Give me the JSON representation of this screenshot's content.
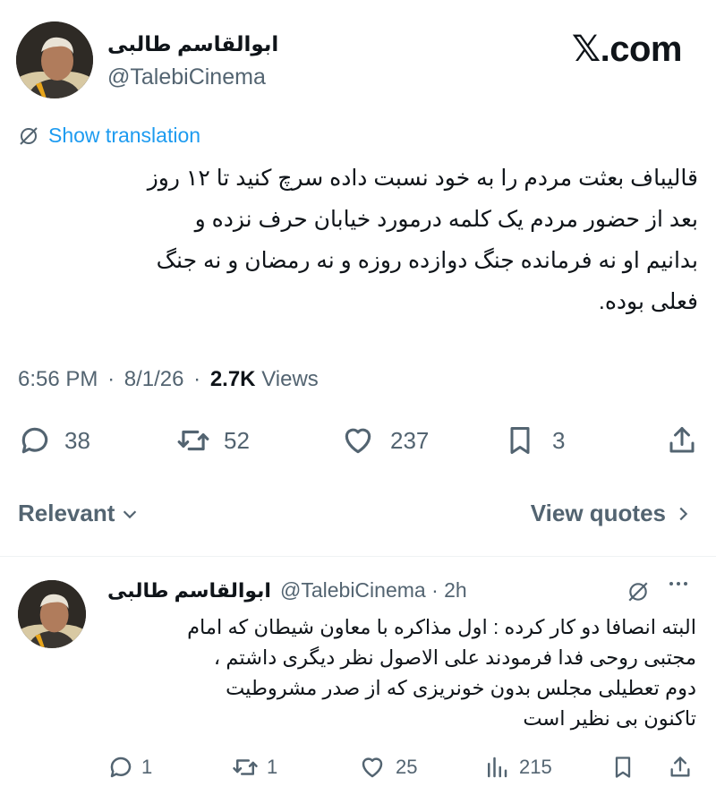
{
  "watermark": "𝕏.com",
  "main_post": {
    "author_name": "ابوالقاسم طالبی",
    "handle": "@TalebiCinema",
    "show_translation": "Show translation",
    "text_lines": [
      "قالیباف بعثت مردم را به خود نسبت داده سرچ کنید تا ۱۲ روز",
      "بعد از حضور مردم  یک کلمه درمورد خیابان حرف نزده و",
      "بدانیم او نه فرمانده جنگ دوازده روزه و نه رمضان و نه جنگ",
      "فعلی بوده."
    ],
    "time": "6:56 PM",
    "dot1": "·",
    "date": "8/1/26",
    "dot2": "·",
    "views_count": "2.7K",
    "views_label": "Views",
    "replies": "38",
    "reposts": "52",
    "likes": "237",
    "bookmarks": "3"
  },
  "filter": {
    "relevant_label": "Relevant",
    "view_quotes_label": "View quotes"
  },
  "reply_post": {
    "author_name": "ابوالقاسم طالبی",
    "handle_time": "@TalebiCinema · 2h",
    "text_lines": [
      "البته انصافا دو کار کرده : اول مذاکره با معاون شیطان که امام",
      "مجتبی روحی فدا فرمودند علی الاصول نظر دیگری داشتم ،",
      "دوم تعطیلی مجلس بدون خونریزی که از صدر مشروطیت",
      "تاکنون بی نظیر است"
    ],
    "replies": "1",
    "reposts": "1",
    "likes": "25",
    "views": "215"
  },
  "icons": {
    "translate": "translate-icon",
    "reply": "reply-icon",
    "repost": "repost-icon",
    "like": "heart-icon",
    "bookmark": "bookmark-icon",
    "share": "share-icon",
    "views": "views-icon",
    "more": "more-icon",
    "chevron_down": "chevron-down-icon",
    "chevron_right": "chevron-right-icon"
  },
  "colors": {
    "link": "#1d9bf0",
    "text": "#0f1419",
    "muted": "#536471"
  }
}
